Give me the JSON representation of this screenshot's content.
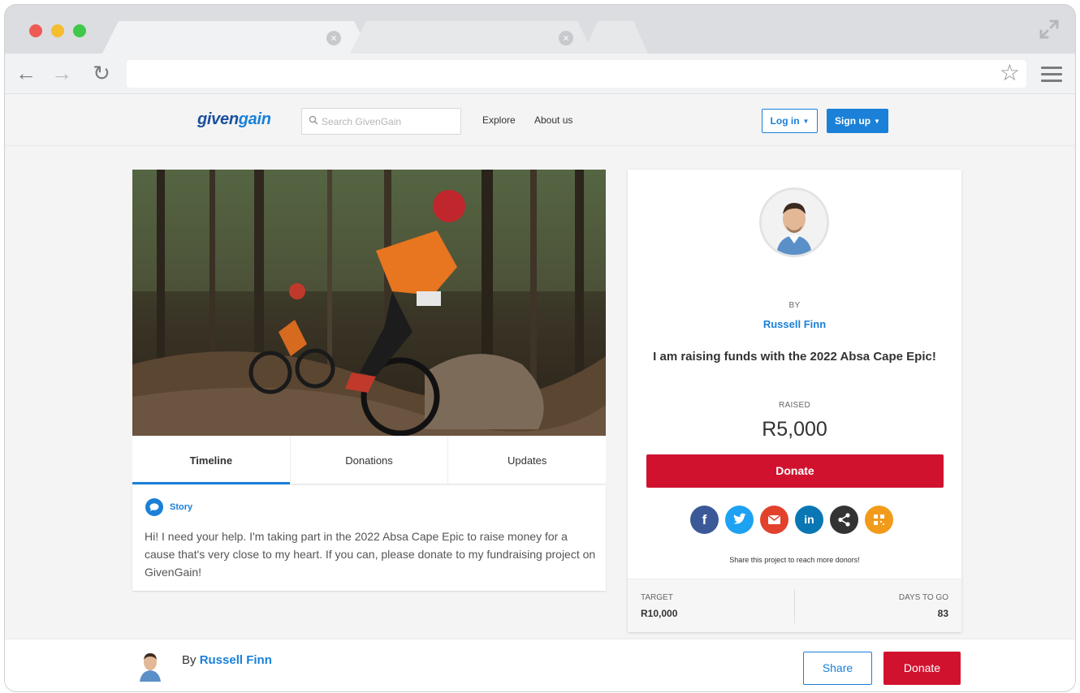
{
  "site": {
    "logo_part1": "given",
    "logo_part2": "gain",
    "search_placeholder": "Search GivenGain",
    "nav": {
      "explore": "Explore",
      "about": "About us"
    },
    "login_label": "Log in",
    "signup_label": "Sign up"
  },
  "tabs": [
    "Timeline",
    "Donations",
    "Updates"
  ],
  "story": {
    "label": "Story",
    "text": "Hi! I need your help. I'm taking part in the 2022 Absa Cape Epic to raise money for a cause that's very close to my heart. If you can, please donate to my fundraising project on GivenGain!"
  },
  "campaign": {
    "by_label": "BY",
    "owner": "Russell Finn",
    "headline": "I am raising funds with the 2022 Absa Cape Epic!",
    "raised_label": "RAISED",
    "raised_amount": "R5,000",
    "donate_label": "Donate",
    "share_hint": "Share this project to reach more donors!",
    "target_label": "TARGET",
    "target_value": "R10,000",
    "days_label": "DAYS TO GO",
    "days_value": "83"
  },
  "socials": [
    "facebook-icon",
    "twitter-icon",
    "email-icon",
    "linkedin-icon",
    "share-icon",
    "qr-code-icon"
  ],
  "sticky": {
    "by_prefix": "By",
    "owner": "Russell Finn",
    "share_label": "Share",
    "donate_label": "Donate"
  },
  "colors": {
    "brand_blue": "#1a80d8",
    "donate_red": "#d0122f",
    "logo_dark": "#1a4f9c"
  }
}
